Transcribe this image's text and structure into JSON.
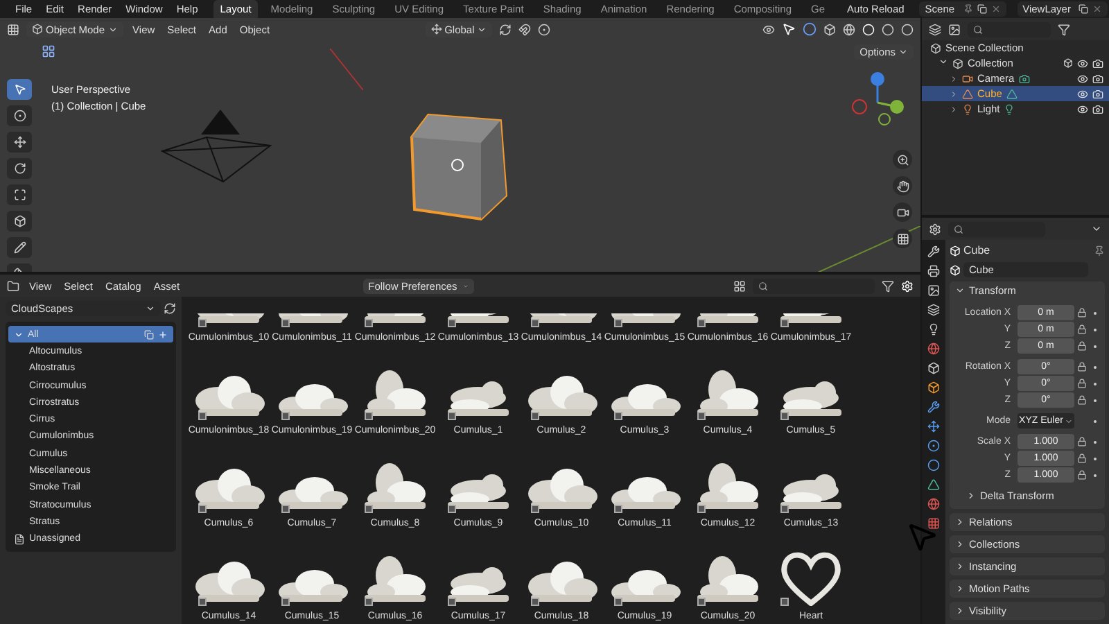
{
  "top_bar": {
    "menus": [
      "File",
      "Edit",
      "Render",
      "Window",
      "Help"
    ],
    "workspaces": [
      {
        "label": "Layout",
        "selected": true
      },
      {
        "label": "Modeling",
        "selected": false
      },
      {
        "label": "Sculpting",
        "selected": false
      },
      {
        "label": "UV Editing",
        "selected": false
      },
      {
        "label": "Texture Paint",
        "selected": false
      },
      {
        "label": "Shading",
        "selected": false
      },
      {
        "label": "Animation",
        "selected": false
      },
      {
        "label": "Rendering",
        "selected": false
      },
      {
        "label": "Compositing",
        "selected": false
      },
      {
        "label": "Ge",
        "selected": false
      }
    ],
    "auto_reload": "Auto Reload",
    "scene": "Scene",
    "view_layer": "ViewLayer"
  },
  "viewport": {
    "mode": "Object Mode",
    "menus": [
      "View",
      "Select",
      "Add",
      "Object"
    ],
    "orientation": "Global",
    "options": "Options",
    "view_name": "User Perspective",
    "context": "(1) Collection | Cube"
  },
  "outliner": {
    "root": "Scene Collection",
    "collection": {
      "label": "Collection",
      "expanded": true,
      "children": [
        {
          "label": "Camera",
          "kind": "camera",
          "selected": false,
          "expanded": false
        },
        {
          "label": "Cube",
          "kind": "mesh",
          "selected": true,
          "expanded": false
        },
        {
          "label": "Light",
          "kind": "light",
          "selected": false,
          "expanded": false
        }
      ]
    }
  },
  "properties": {
    "object_title": "Cube",
    "object_name": "Cube",
    "panel": "Transform",
    "groups": [
      [
        {
          "label": "Location X",
          "value": "0 m",
          "kind": "field"
        },
        {
          "label": "Y",
          "value": "0 m",
          "kind": "field"
        },
        {
          "label": "Z",
          "value": "0 m",
          "kind": "field"
        }
      ],
      [
        {
          "label": "Rotation X",
          "value": "0°",
          "kind": "field"
        },
        {
          "label": "Y",
          "value": "0°",
          "kind": "field"
        },
        {
          "label": "Z",
          "value": "0°",
          "kind": "field"
        }
      ],
      [
        {
          "label": "Mode",
          "value": "XYZ Euler",
          "kind": "dropdown"
        }
      ],
      [
        {
          "label": "Scale X",
          "value": "1.000",
          "kind": "field"
        },
        {
          "label": "Y",
          "value": "1.000",
          "kind": "field"
        },
        {
          "label": "Z",
          "value": "1.000",
          "kind": "field"
        }
      ]
    ],
    "subpanel": "Delta Transform",
    "panels": [
      "Relations",
      "Collections",
      "Instancing",
      "Motion Paths",
      "Visibility"
    ]
  },
  "asset_browser": {
    "menus": [
      "View",
      "Select",
      "Catalog",
      "Asset"
    ],
    "import_method": "Follow Preferences",
    "library": "CloudScapes",
    "catalogs": [
      {
        "label": "All",
        "selected": true,
        "kind": "root"
      },
      {
        "label": "Altocumulus",
        "selected": false,
        "kind": "catalog"
      },
      {
        "label": "Altostratus",
        "selected": false,
        "kind": "catalog"
      },
      {
        "label": "Cirrocumulus",
        "selected": false,
        "kind": "catalog"
      },
      {
        "label": "Cirrostratus",
        "selected": false,
        "kind": "catalog"
      },
      {
        "label": "Cirrus",
        "selected": false,
        "kind": "catalog"
      },
      {
        "label": "Cumulonimbus",
        "selected": false,
        "kind": "catalog"
      },
      {
        "label": "Cumulus",
        "selected": false,
        "kind": "catalog"
      },
      {
        "label": "Miscellaneous",
        "selected": false,
        "kind": "catalog"
      },
      {
        "label": "Smoke Trail",
        "selected": false,
        "kind": "catalog"
      },
      {
        "label": "Stratocumulus",
        "selected": false,
        "kind": "catalog"
      },
      {
        "label": "Stratus",
        "selected": false,
        "kind": "catalog"
      },
      {
        "label": "Unassigned",
        "selected": false,
        "kind": "unassigned"
      }
    ],
    "assets": [
      {
        "name": "Cumulonimbus_10",
        "kind": "partial"
      },
      {
        "name": "Cumulonimbus_11",
        "kind": "partial"
      },
      {
        "name": "Cumulonimbus_12",
        "kind": "partial"
      },
      {
        "name": "Cumulonimbus_13",
        "kind": "partial"
      },
      {
        "name": "Cumulonimbus_14",
        "kind": "partial"
      },
      {
        "name": "Cumulonimbus_15",
        "kind": "partial"
      },
      {
        "name": "Cumulonimbus_16",
        "kind": "partial"
      },
      {
        "name": "Cumulonimbus_17",
        "kind": "partial"
      },
      {
        "name": "Cumulonimbus_18",
        "kind": "cloud"
      },
      {
        "name": "Cumulonimbus_19",
        "kind": "cloud"
      },
      {
        "name": "Cumulonimbus_20",
        "kind": "cloud"
      },
      {
        "name": "Cumulus_1",
        "kind": "cloud"
      },
      {
        "name": "Cumulus_2",
        "kind": "cloud"
      },
      {
        "name": "Cumulus_3",
        "kind": "cloud"
      },
      {
        "name": "Cumulus_4",
        "kind": "cloud"
      },
      {
        "name": "Cumulus_5",
        "kind": "cloud"
      },
      {
        "name": "Cumulus_6",
        "kind": "cloud"
      },
      {
        "name": "Cumulus_7",
        "kind": "cloud"
      },
      {
        "name": "Cumulus_8",
        "kind": "cloud"
      },
      {
        "name": "Cumulus_9",
        "kind": "cloud"
      },
      {
        "name": "Cumulus_10",
        "kind": "cloud"
      },
      {
        "name": "Cumulus_11",
        "kind": "cloud"
      },
      {
        "name": "Cumulus_12",
        "kind": "cloud"
      },
      {
        "name": "Cumulus_13",
        "kind": "cloud"
      },
      {
        "name": "Cumulus_14",
        "kind": "cloud"
      },
      {
        "name": "Cumulus_15",
        "kind": "cloud"
      },
      {
        "name": "Cumulus_16",
        "kind": "cloud"
      },
      {
        "name": "Cumulus_17",
        "kind": "cloud"
      },
      {
        "name": "Cumulus_18",
        "kind": "cloud"
      },
      {
        "name": "Cumulus_19",
        "kind": "cloud"
      },
      {
        "name": "Cumulus_20",
        "kind": "cloud"
      },
      {
        "name": "Heart",
        "kind": "heart"
      }
    ]
  }
}
